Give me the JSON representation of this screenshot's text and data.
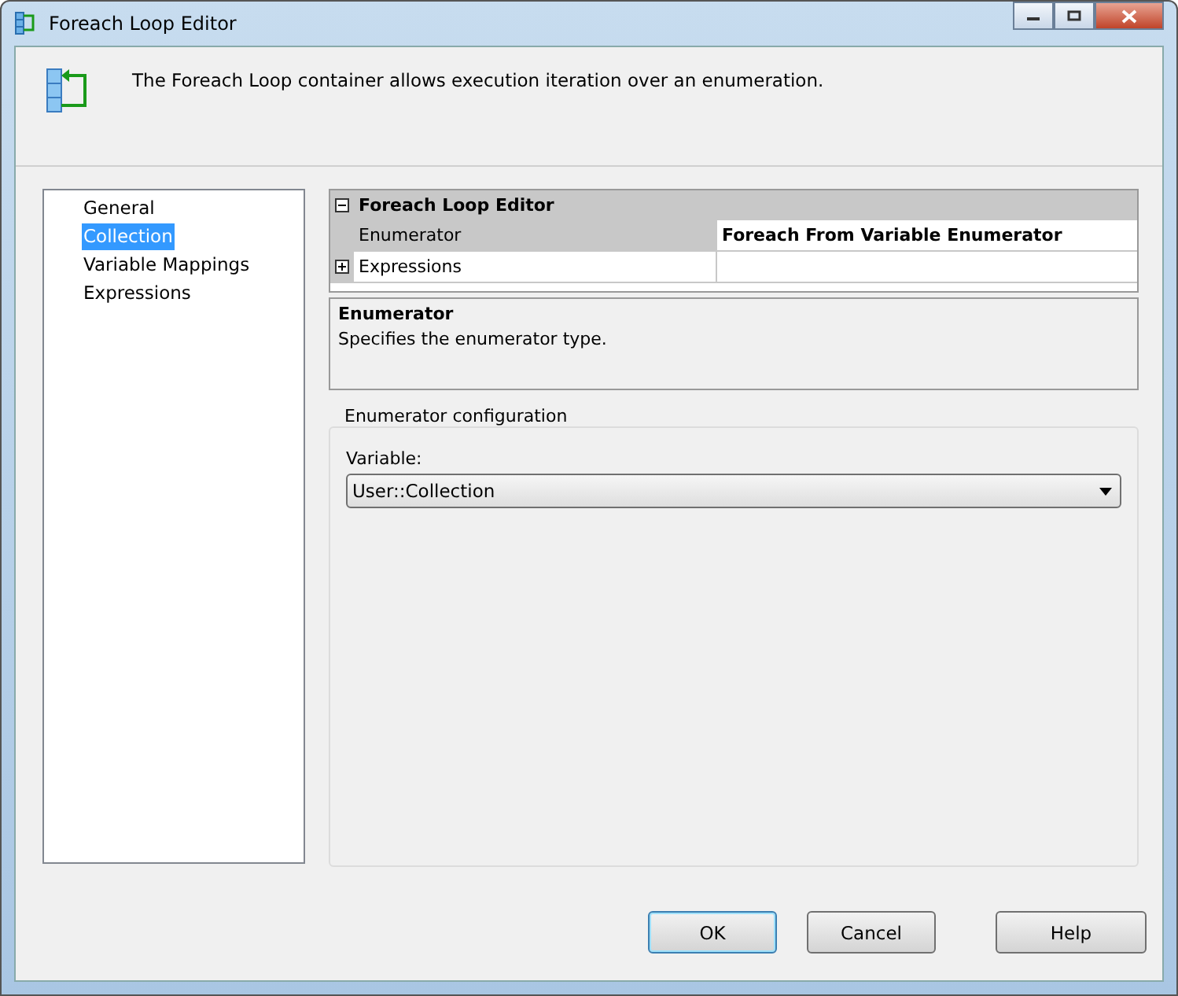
{
  "window": {
    "title": "Foreach Loop Editor"
  },
  "header": {
    "text": "The Foreach Loop container allows execution iteration over an enumeration."
  },
  "nav": [
    {
      "label": "General",
      "selected": false
    },
    {
      "label": "Collection",
      "selected": true
    },
    {
      "label": "Variable Mappings",
      "selected": false
    },
    {
      "label": "Expressions",
      "selected": false
    }
  ],
  "property_grid": {
    "category": "Foreach Loop Editor",
    "expanded": true,
    "rows": [
      {
        "name": "Enumerator",
        "value": "Foreach From Variable Enumerator",
        "expandable": false,
        "selected": true
      },
      {
        "name": "Expressions",
        "expandable": true,
        "selected": false
      }
    ]
  },
  "description": {
    "title": "Enumerator",
    "text": "Specifies the enumerator type."
  },
  "group": {
    "title": "Enumerator configuration",
    "field_label": "Variable:",
    "dropdown_value": "User::Collection"
  },
  "buttons": [
    {
      "label": "OK",
      "default": true
    },
    {
      "label": "Cancel",
      "default": false
    },
    {
      "label": "Help",
      "default": false
    }
  ]
}
